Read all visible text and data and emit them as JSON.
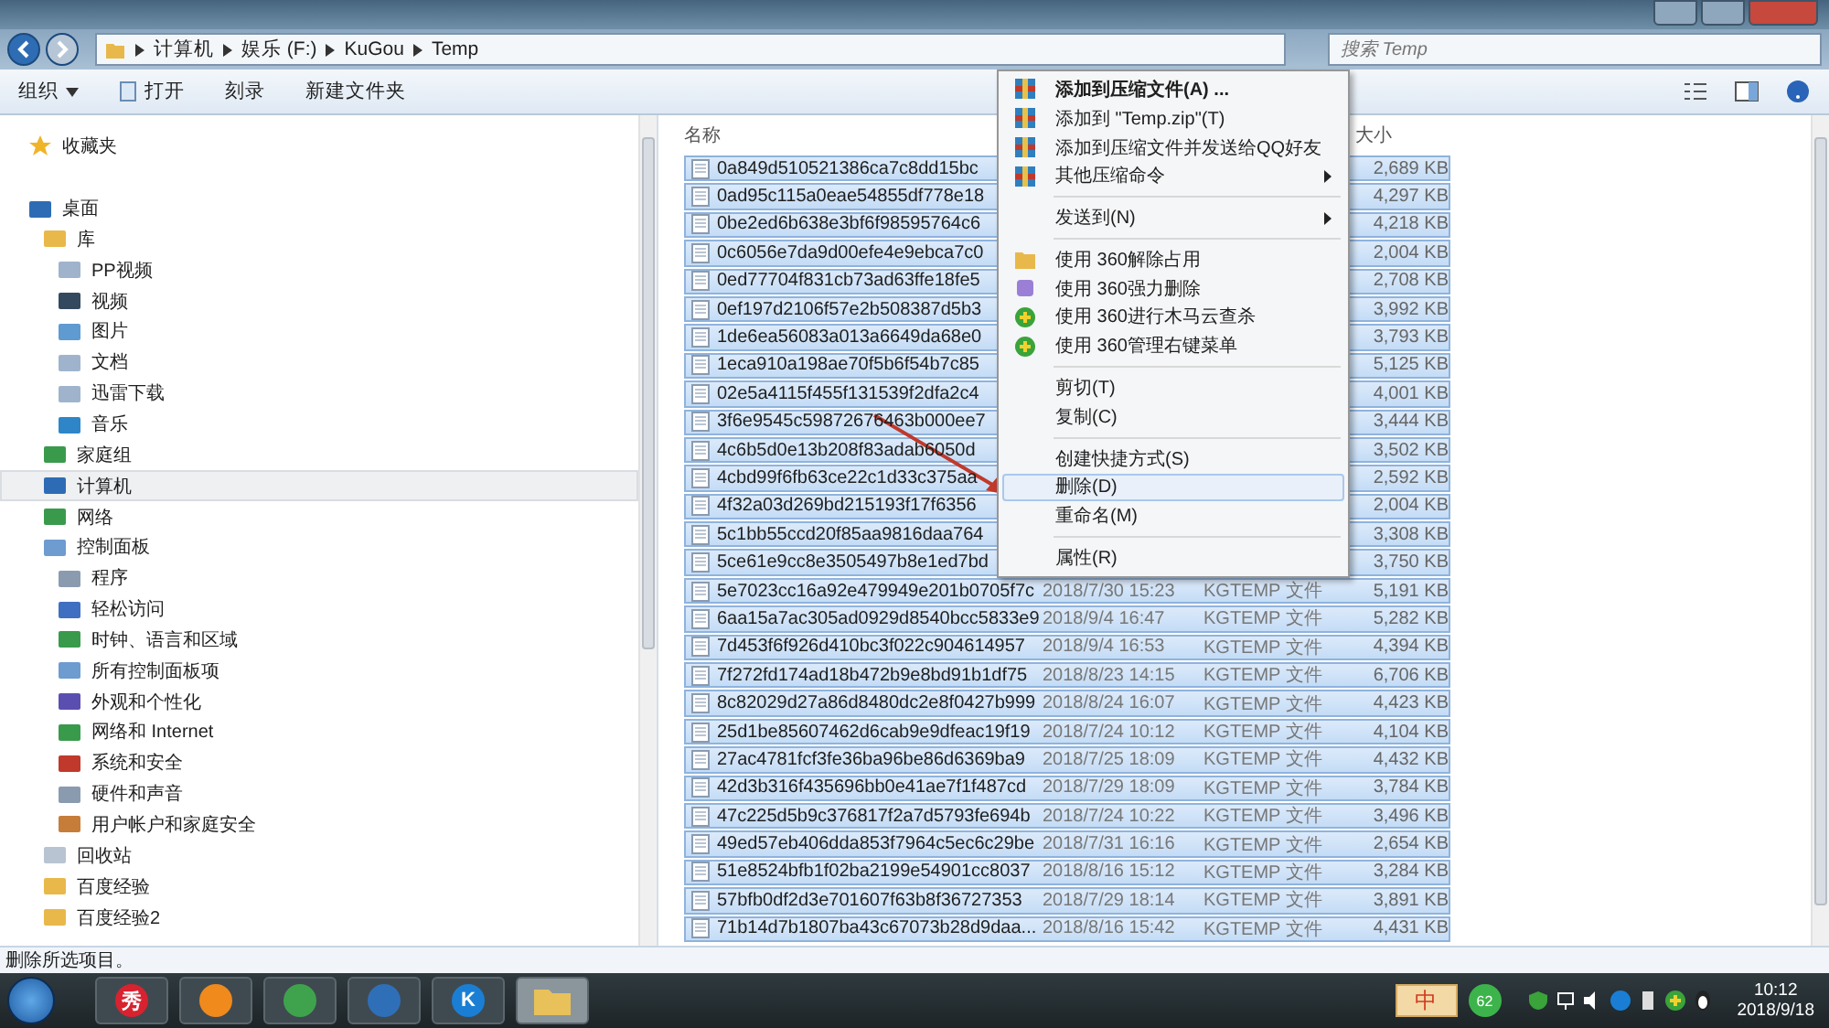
{
  "address": {
    "crumbs": [
      "计算机",
      "娱乐 (F:)",
      "KuGou",
      "Temp"
    ]
  },
  "search": {
    "placeholder": "搜索 Temp"
  },
  "toolbar": [
    {
      "label": "组织",
      "kind": "dropdown"
    },
    {
      "label": "打开",
      "kind": "open"
    },
    {
      "label": "刻录",
      "kind": "plain"
    },
    {
      "label": "新建文件夹",
      "kind": "plain"
    }
  ],
  "favorites": {
    "label": "收藏夹"
  },
  "nav": [
    {
      "label": "桌面",
      "selected": false,
      "children": [
        {
          "label": "库",
          "selected": false,
          "children": [
            {
              "label": "PP视频",
              "selected": false
            },
            {
              "label": "视频",
              "selected": false
            },
            {
              "label": "图片",
              "selected": false
            },
            {
              "label": "文档",
              "selected": false
            },
            {
              "label": "迅雷下载",
              "selected": false
            },
            {
              "label": "音乐",
              "selected": false
            }
          ]
        },
        {
          "label": "家庭组",
          "selected": false
        },
        {
          "label": "计算机",
          "selected": true
        },
        {
          "label": "网络",
          "selected": false
        },
        {
          "label": "控制面板",
          "selected": false,
          "children": [
            {
              "label": "程序",
              "selected": false
            },
            {
              "label": "轻松访问",
              "selected": false
            },
            {
              "label": "时钟、语言和区域",
              "selected": false
            },
            {
              "label": "所有控制面板项",
              "selected": false
            },
            {
              "label": "外观和个性化",
              "selected": false
            },
            {
              "label": "网络和 Internet",
              "selected": false
            },
            {
              "label": "系统和安全",
              "selected": false
            },
            {
              "label": "硬件和声音",
              "selected": false
            },
            {
              "label": "用户帐户和家庭安全",
              "selected": false
            }
          ]
        },
        {
          "label": "回收站",
          "selected": false
        },
        {
          "label": "百度经验",
          "selected": false
        },
        {
          "label": "百度经验2",
          "selected": false
        }
      ]
    }
  ],
  "columns": {
    "name": "名称",
    "size": "大小"
  },
  "files": [
    {
      "name": "0a849d510521386ca7c8dd15bc",
      "size": "2,689 KB",
      "selected": true
    },
    {
      "name": "0ad95c115a0eae54855df778e18",
      "size": "4,297 KB",
      "selected": true
    },
    {
      "name": "0be2ed6b638e3bf6f98595764c6",
      "size": "4,218 KB",
      "selected": true
    },
    {
      "name": "0c6056e7da9d00efe4e9ebca7c0",
      "size": "2,004 KB",
      "selected": true
    },
    {
      "name": "0ed77704f831cb73ad63ffe18fe5",
      "size": "2,708 KB",
      "selected": true
    },
    {
      "name": "0ef197d2106f57e2b508387d5b3",
      "size": "3,992 KB",
      "selected": true
    },
    {
      "name": "1de6ea56083a013a6649da68e0",
      "size": "3,793 KB",
      "selected": true
    },
    {
      "name": "1eca910a198ae70f5b6f54b7c85",
      "size": "5,125 KB",
      "selected": true
    },
    {
      "name": "02e5a4115f455f131539f2dfa2c4",
      "size": "4,001 KB",
      "selected": true
    },
    {
      "name": "3f6e9545c59872676463b000ee7",
      "size": "3,444 KB",
      "selected": true
    },
    {
      "name": "4c6b5d0e13b208f83adab6050d",
      "size": "3,502 KB",
      "selected": true
    },
    {
      "name": "4cbd99f6fb63ce22c1d33c375aa",
      "size": "2,592 KB",
      "selected": true
    },
    {
      "name": "4f32a03d269bd215193f17f6356",
      "size": "2,004 KB",
      "selected": true
    },
    {
      "name": "5c1bb55ccd20f85aa9816daa764",
      "size": "3,308 KB",
      "selected": true
    },
    {
      "name": "5ce61e9cc8e3505497b8e1ed7bd",
      "size": "3,750 KB",
      "selected": true
    },
    {
      "name": "5e7023cc16a92e479949e201b0705f7c",
      "date": "2018/7/30 15:23",
      "type": "KGTEMP 文件",
      "size": "5,191 KB",
      "selected": true
    },
    {
      "name": "6aa15a7ac305ad0929d8540bcc5833e9",
      "date": "2018/9/4 16:47",
      "type": "KGTEMP 文件",
      "size": "5,282 KB",
      "selected": true
    },
    {
      "name": "7d453f6f926d410bc3f022c904614957",
      "date": "2018/9/4 16:53",
      "type": "KGTEMP 文件",
      "size": "4,394 KB",
      "selected": true
    },
    {
      "name": "7f272fd174ad18b472b9e8bd91b1df75",
      "date": "2018/8/23 14:15",
      "type": "KGTEMP 文件",
      "size": "6,706 KB",
      "selected": true
    },
    {
      "name": "8c82029d27a86d8480dc2e8f0427b999",
      "date": "2018/8/24 16:07",
      "type": "KGTEMP 文件",
      "size": "4,423 KB",
      "selected": true
    },
    {
      "name": "25d1be85607462d6cab9e9dfeac19f19",
      "date": "2018/7/24 10:12",
      "type": "KGTEMP 文件",
      "size": "4,104 KB",
      "selected": true
    },
    {
      "name": "27ac4781fcf3fe36ba96be86d6369ba9",
      "date": "2018/7/25 18:09",
      "type": "KGTEMP 文件",
      "size": "4,432 KB",
      "selected": true
    },
    {
      "name": "42d3b316f435696bb0e41ae7f1f487cd",
      "date": "2018/7/29 18:09",
      "type": "KGTEMP 文件",
      "size": "3,784 KB",
      "selected": true
    },
    {
      "name": "47c225d5b9c376817f2a7d5793fe694b",
      "date": "2018/7/24 10:22",
      "type": "KGTEMP 文件",
      "size": "3,496 KB",
      "selected": true
    },
    {
      "name": "49ed57eb406dda853f7964c5ec6c29be",
      "date": "2018/7/31 16:16",
      "type": "KGTEMP 文件",
      "size": "2,654 KB",
      "selected": true
    },
    {
      "name": "51e8524bfb1f02ba2199e54901cc8037",
      "date": "2018/8/16 15:12",
      "type": "KGTEMP 文件",
      "size": "3,284 KB",
      "selected": true
    },
    {
      "name": "57bfb0df2d3e701607f63b8f36727353",
      "date": "2018/7/29 18:14",
      "type": "KGTEMP 文件",
      "size": "3,891 KB",
      "selected": true
    },
    {
      "name": "71b14d7b1807ba43c67073b28d9daa...",
      "date": "2018/8/16 15:42",
      "type": "KGTEMP 文件",
      "size": "4,431 KB",
      "selected": true
    }
  ],
  "context_menu": [
    {
      "kind": "archive",
      "label": "添加到压缩文件(A) ...",
      "bold": true,
      "submenu": false,
      "highlighted": false
    },
    {
      "kind": "archive",
      "label": "添加到 \"Temp.zip\"(T)",
      "bold": false,
      "submenu": false,
      "highlighted": false
    },
    {
      "kind": "archive",
      "label": "添加到压缩文件并发送给QQ好友",
      "bold": false,
      "submenu": false,
      "highlighted": false
    },
    {
      "kind": "archive",
      "label": "其他压缩命令",
      "bold": false,
      "submenu": true,
      "highlighted": false
    },
    {
      "kind": "separator"
    },
    {
      "kind": "plain",
      "label": "发送到(N)",
      "bold": false,
      "submenu": true,
      "highlighted": false
    },
    {
      "kind": "separator"
    },
    {
      "kind": "unlock",
      "label": "使用 360解除占用",
      "bold": false,
      "submenu": false,
      "highlighted": false
    },
    {
      "kind": "shred",
      "label": "使用 360强力删除",
      "bold": false,
      "submenu": false,
      "highlighted": false
    },
    {
      "kind": "guard",
      "label": "使用 360进行木马云查杀",
      "bold": false,
      "submenu": false,
      "highlighted": false
    },
    {
      "kind": "guard",
      "label": "使用 360管理右键菜单",
      "bold": false,
      "submenu": false,
      "highlighted": false
    },
    {
      "kind": "separator"
    },
    {
      "kind": "plain",
      "label": "剪切(T)",
      "bold": false,
      "submenu": false,
      "highlighted": false
    },
    {
      "kind": "plain",
      "label": "复制(C)",
      "bold": false,
      "submenu": false,
      "highlighted": false
    },
    {
      "kind": "separator"
    },
    {
      "kind": "plain",
      "label": "创建快捷方式(S)",
      "bold": false,
      "submenu": false,
      "highlighted": false
    },
    {
      "kind": "plain",
      "label": "删除(D)",
      "bold": false,
      "submenu": false,
      "highlighted": true
    },
    {
      "kind": "plain",
      "label": "重命名(M)",
      "bold": false,
      "submenu": false,
      "highlighted": false
    },
    {
      "kind": "separator"
    },
    {
      "kind": "plain",
      "label": "属性(R)",
      "bold": false,
      "submenu": false,
      "highlighted": false
    }
  ],
  "status_bar": {
    "text": "删除所选项目。"
  },
  "taskbar": [
    {
      "kind": "start"
    },
    {
      "kind": "letter",
      "label": "秀"
    },
    {
      "kind": "app"
    },
    {
      "kind": "app"
    },
    {
      "kind": "app"
    },
    {
      "kind": "letter",
      "label": "K"
    },
    {
      "kind": "explorer"
    }
  ],
  "ime": {
    "label": "中",
    "badge": "62"
  },
  "clock": {
    "time": "10:12",
    "date": "2018/9/18"
  }
}
